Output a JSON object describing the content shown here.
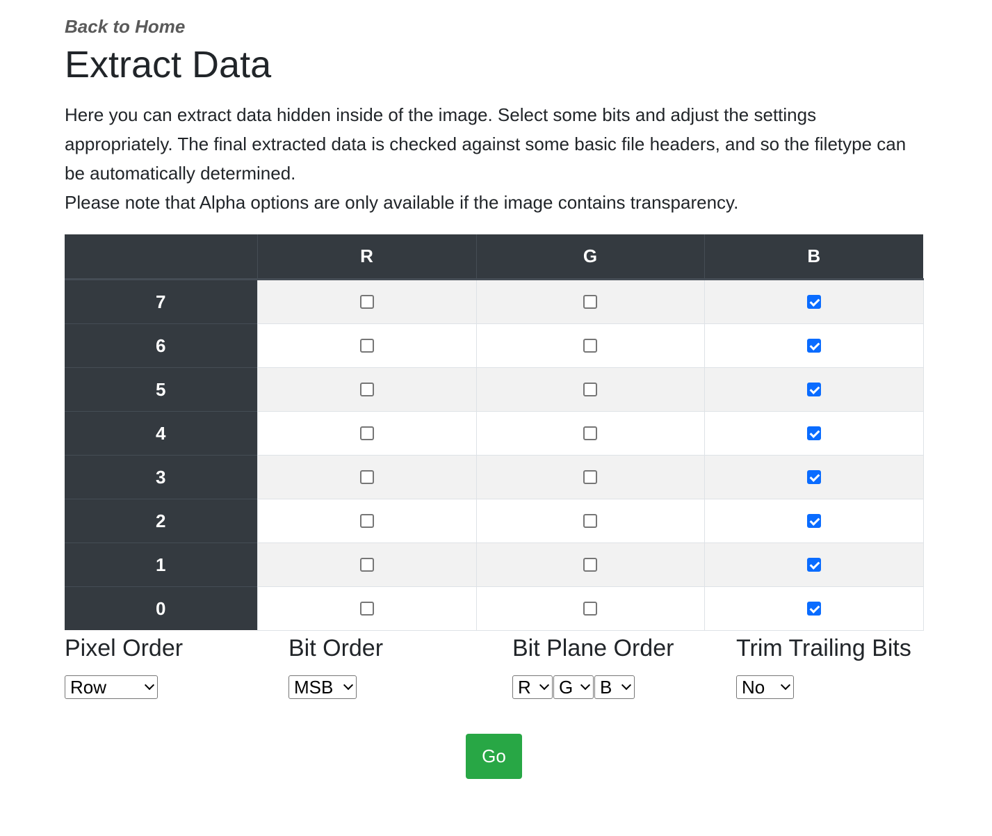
{
  "nav": {
    "back_label": "Back to Home"
  },
  "page": {
    "title": "Extract Data",
    "description_1": "Here you can extract data hidden inside of the image. Select some bits and adjust the settings appropriately. The final extracted data is checked against some basic file headers, and so the filetype can be automatically determined.",
    "description_2": "Please note that Alpha options are only available if the image contains transparency."
  },
  "bit_table": {
    "columns": [
      "R",
      "G",
      "B"
    ],
    "rows": [
      {
        "bit": "7",
        "R": false,
        "G": false,
        "B": true
      },
      {
        "bit": "6",
        "R": false,
        "G": false,
        "B": true
      },
      {
        "bit": "5",
        "R": false,
        "G": false,
        "B": true
      },
      {
        "bit": "4",
        "R": false,
        "G": false,
        "B": true
      },
      {
        "bit": "3",
        "R": false,
        "G": false,
        "B": true
      },
      {
        "bit": "2",
        "R": false,
        "G": false,
        "B": true
      },
      {
        "bit": "1",
        "R": false,
        "G": false,
        "B": true
      },
      {
        "bit": "0",
        "R": false,
        "G": false,
        "B": true
      }
    ]
  },
  "options": {
    "pixel_order": {
      "label": "Pixel Order",
      "value": "Row"
    },
    "bit_order": {
      "label": "Bit Order",
      "value": "MSB"
    },
    "bit_plane_order": {
      "label": "Bit Plane Order",
      "values": [
        "R",
        "G",
        "B"
      ]
    },
    "trim_trailing_bits": {
      "label": "Trim Trailing Bits",
      "value": "No"
    }
  },
  "actions": {
    "go_label": "Go"
  },
  "colors": {
    "header_bg": "#343a40",
    "go_button": "#28a745",
    "checkbox_checked": "#0a6cff"
  }
}
